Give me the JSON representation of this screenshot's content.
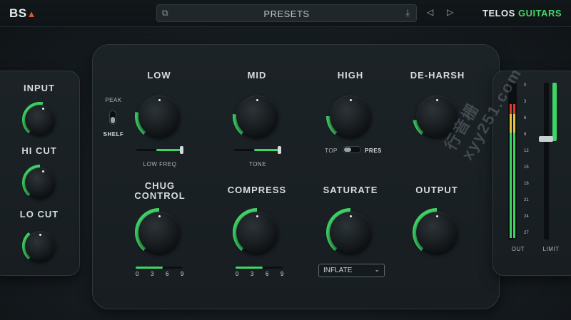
{
  "header": {
    "logo": "BS",
    "logo_mark": "▲",
    "presets_label": "PRESETS",
    "preset_icon_left": "open-external-icon",
    "preset_icon_right": "download-icon",
    "prev_icon": "◁",
    "next_icon": "▷",
    "brand_main": "TELOS",
    "brand_accent": "GUITARS"
  },
  "left": {
    "input_label": "INPUT",
    "hicut_label": "HI CUT",
    "locut_label": "LO CUT"
  },
  "eq": {
    "low_label": "LOW",
    "mid_label": "MID",
    "high_label": "HIGH",
    "deharsh_label": "DE-HARSH",
    "peak_label": "PEAK",
    "shelf_label": "SHELF",
    "low_freq_label": "LOW FREQ",
    "tone_label": "TONE",
    "top_label": "TOP",
    "pres_label": "PRES",
    "low_freq_value": 0.85,
    "tone_value": 0.85
  },
  "dynamics": {
    "chug_label_1": "CHUG",
    "chug_label_2": "CONTROL",
    "compress_label": "COMPRESS",
    "saturate_label": "SATURATE",
    "output_label": "OUTPUT",
    "chug_steps": [
      "0",
      "3",
      "6",
      "9"
    ],
    "compress_steps": [
      "0",
      "3",
      "6",
      "9"
    ],
    "chug_value": 0.55,
    "compress_value": 0.55,
    "saturate_mode": "INFLATE"
  },
  "meters": {
    "scale": [
      "0",
      "3",
      "6",
      "9",
      "12",
      "15",
      "18",
      "21",
      "24",
      "27"
    ],
    "out_label": "OUT",
    "limit_label": "LIMIT"
  },
  "watermark": "行音栅 xyy251.com",
  "colors": {
    "accent": "#3fd466",
    "logo_mark": "#e0553a",
    "meter_red": "#e4382c",
    "meter_yellow": "#e2c63a"
  }
}
